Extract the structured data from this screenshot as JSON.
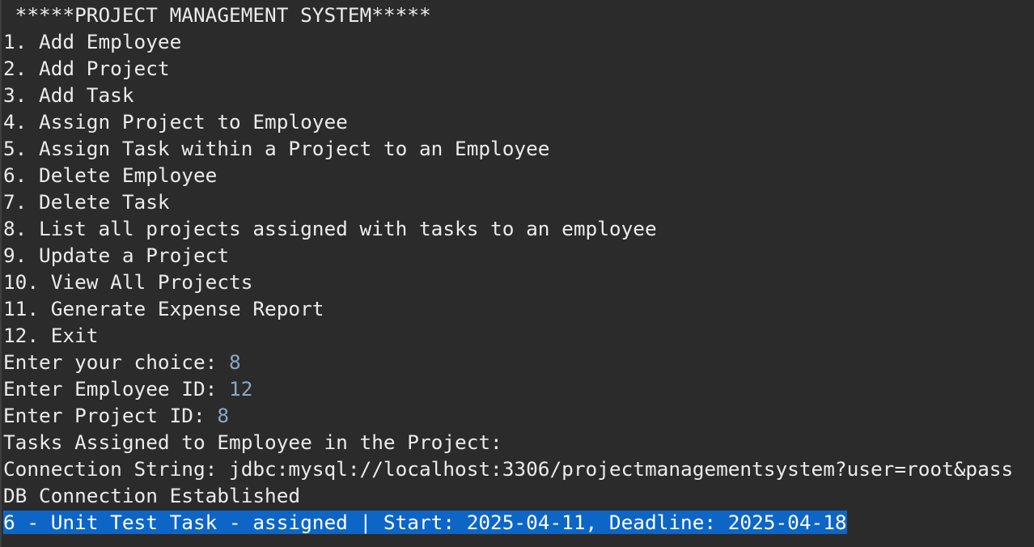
{
  "title": " *****PROJECT MANAGEMENT SYSTEM*****",
  "menu": [
    "1. Add Employee",
    "2. Add Project",
    "3. Add Task",
    "4. Assign Project to Employee",
    "5. Assign Task within a Project to an Employee",
    "6. Delete Employee",
    "7. Delete Task",
    "8. List all projects assigned with tasks to an employee",
    "9. Update a Project",
    "10. View All Projects",
    "11. Generate Expense Report",
    "12. Exit"
  ],
  "prompts": [
    {
      "label": "Enter your choice: ",
      "value": "8"
    },
    {
      "label": "Enter Employee ID: ",
      "value": "12"
    },
    {
      "label": "Enter Project ID: ",
      "value": "8"
    }
  ],
  "output": {
    "header": "Tasks Assigned to Employee in the Project:",
    "connection": "Connection String: jdbc:mysql://localhost:3306/projectmanagementsystem?user=root&pass",
    "established": "DB Connection Established",
    "task_line": "6 - Unit Test Task - assigned | Start: 2025-04-11, Deadline: 2025-04-18"
  },
  "colors": {
    "background": "#2b2b2b",
    "text": "#ebebeb",
    "input": "#8aa8c6",
    "selection": "#0d66c6"
  }
}
